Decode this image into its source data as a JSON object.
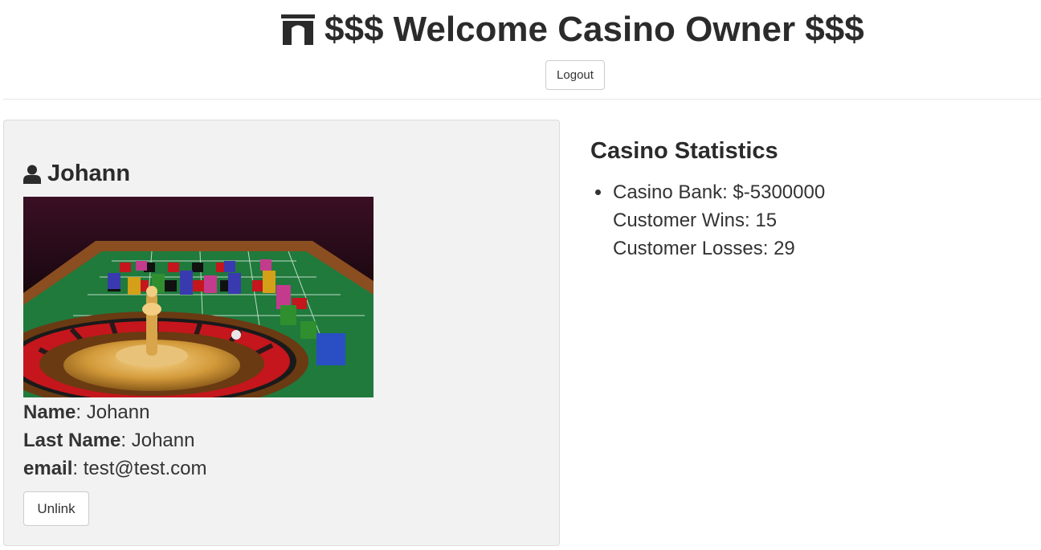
{
  "header": {
    "title": "$$$ Welcome Casino Owner $$$",
    "title_icon": "casino-building-icon",
    "logout_label": "Logout"
  },
  "user_card": {
    "icon": "user-icon",
    "name": "Johann",
    "image_icon": "roulette-table-image",
    "fields": {
      "name_label": "Name",
      "name_value": "Johann",
      "last_name_label": "Last Name",
      "last_name_value": "Johann",
      "email_label": "email",
      "email_value": "test@test.com"
    },
    "unlink_label": "Unlink"
  },
  "stats": {
    "title": "Casino Statistics",
    "bank": "Casino Bank: $-5300000",
    "wins": "Customer Wins: 15",
    "losses": "Customer Losses: 29"
  },
  "colors": {
    "card_bg": "#f2f2f2",
    "text": "#333333",
    "felt_green": "#1f7a3c"
  }
}
